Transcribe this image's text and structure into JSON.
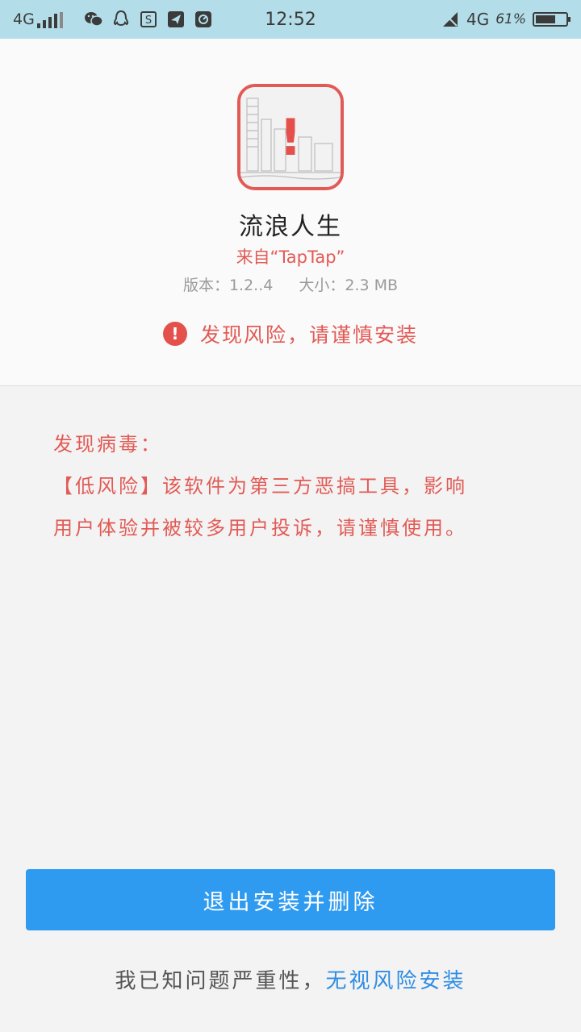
{
  "status_bar": {
    "network": "4G",
    "time": "12:52",
    "network_right": "4G",
    "battery": "61%"
  },
  "app": {
    "name": "流浪人生",
    "source": "来自“TapTap”",
    "version": "版本：1.2..4",
    "size": "大小：2.3 MB"
  },
  "risk": {
    "icon_glyph": "!",
    "label": "发现风险，请谨慎安装"
  },
  "virus": {
    "title": "发现病毒：",
    "line1": "【低风险】该软件为第三方恶搞工具，影响",
    "line2": "用户体验并被较多用户投诉，请谨慎使用。"
  },
  "actions": {
    "exit_delete": "退出安装并删除",
    "ignore_prefix": "我已知问题严重性，",
    "ignore_link": "无视风险安装"
  },
  "colors": {
    "accent_red": "#e25a55",
    "primary_blue": "#2f9bf0",
    "link_blue": "#2f8de4",
    "status_bar_bg": "#b3dde8"
  }
}
